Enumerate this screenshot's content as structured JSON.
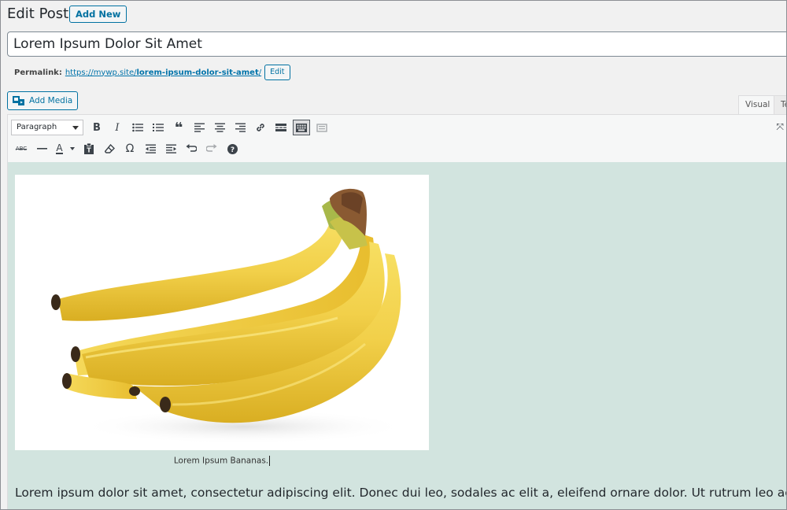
{
  "header": {
    "title": "Edit Post",
    "add_new_label": "Add New"
  },
  "post": {
    "title_value": "Lorem Ipsum Dolor Sit Amet",
    "permalink_label": "Permalink:",
    "permalink_base": "https://mywp.site/",
    "permalink_slug": "lorem-ipsum-dolor-sit-amet",
    "permalink_trailing": "/",
    "permalink_edit_label": "Edit"
  },
  "media": {
    "add_media_label": "Add Media"
  },
  "editor_tabs": {
    "visual": "Visual",
    "text": "Te"
  },
  "toolbar": {
    "format_selected": "Paragraph",
    "row1_icons": [
      "bold-icon",
      "italic-icon",
      "bulleted-list-icon",
      "numbered-list-icon",
      "blockquote-icon",
      "align-left-icon",
      "align-center-icon",
      "align-right-icon",
      "link-icon",
      "read-more-icon",
      "toolbar-toggle-icon",
      "distraction-free-icon"
    ],
    "row2_icons": [
      "strikethrough-icon",
      "horizontal-line-icon",
      "text-color-icon",
      "paste-as-text-icon",
      "clear-formatting-icon",
      "special-character-icon",
      "outdent-icon",
      "indent-icon",
      "undo-icon",
      "redo-icon",
      "help-icon"
    ]
  },
  "content": {
    "image_caption": "Lorem Ipsum Bananas.",
    "paragraph": "Lorem ipsum dolor sit amet, consectetur adipiscing elit. Donec dui leo, sodales ac elit a, eleifend ornare dolor. Ut rutrum leo ac leo"
  },
  "colors": {
    "accent": "#0071a1",
    "editor_background": "#d2e4df",
    "page_background": "#f1f1f1"
  }
}
